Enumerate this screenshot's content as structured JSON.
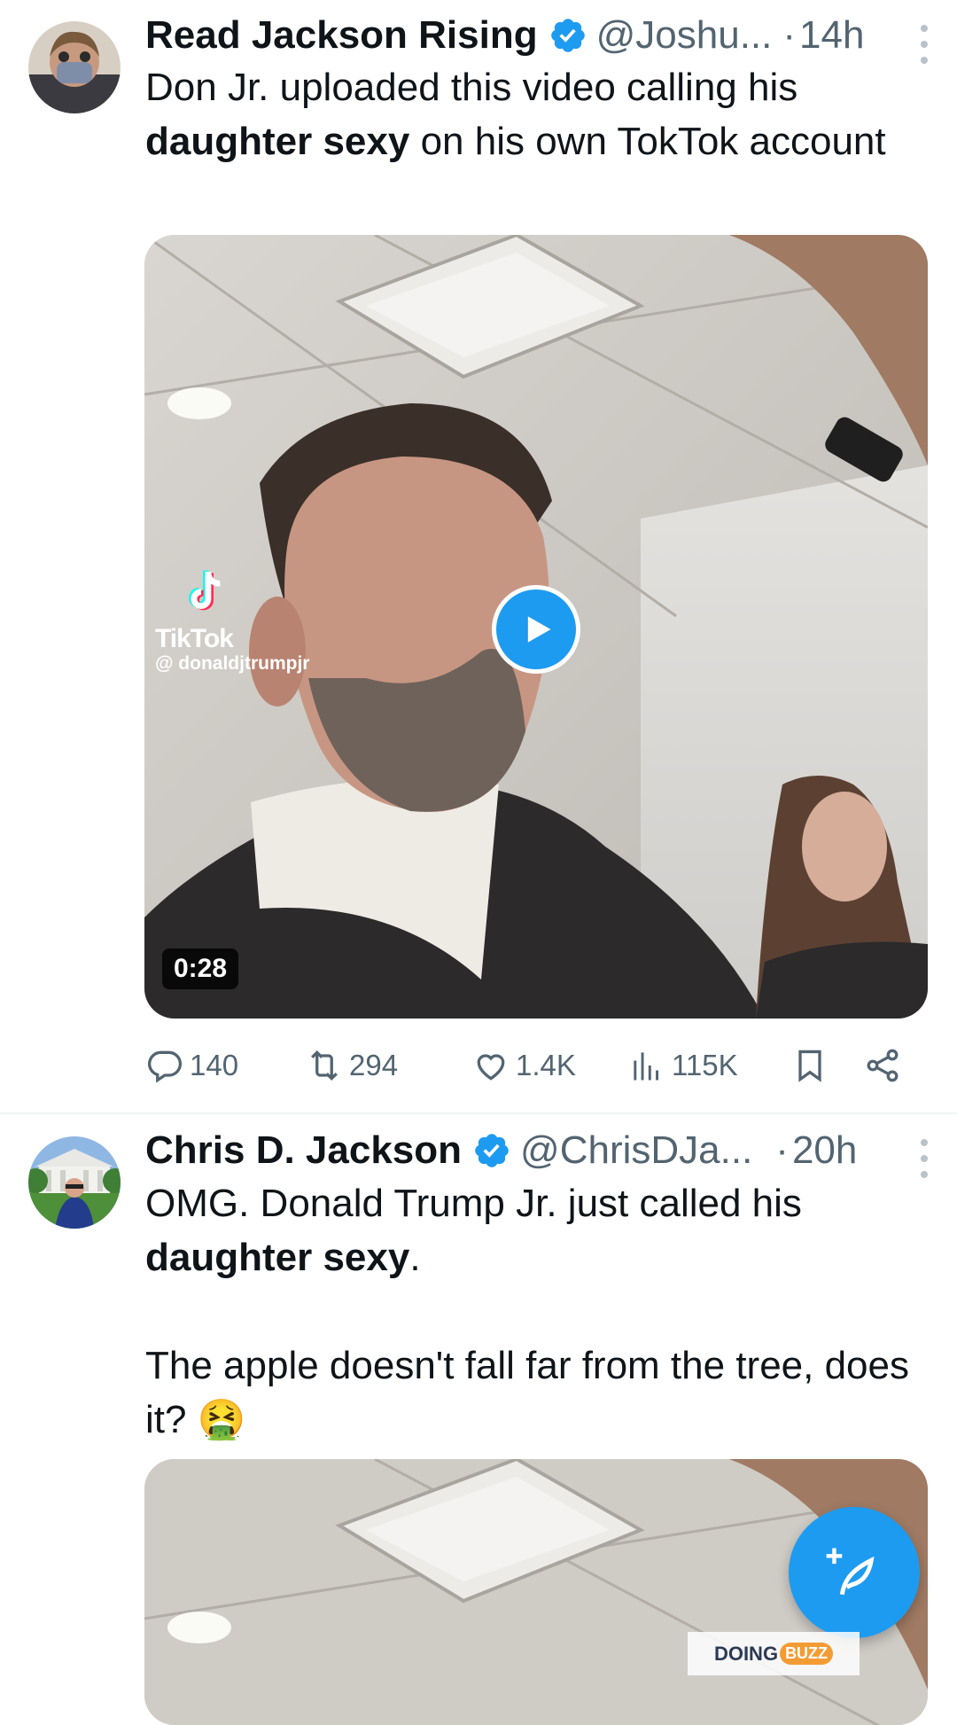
{
  "tweets": [
    {
      "name": "Read Jackson Rising",
      "handle": "@Joshu...",
      "dot": "·",
      "time": "14h",
      "text_parts": [
        "Don Jr. uploaded this video calling his ",
        "daughter sexy",
        " on his own TokTok account"
      ],
      "media": {
        "tiktok_brand": "TikTok",
        "tiktok_user": "@ donaldjtrumpjr",
        "duration": "0:28"
      },
      "actions": {
        "replies": "140",
        "reposts": "294",
        "likes": "1.4K",
        "views": "115K"
      }
    },
    {
      "name": "Chris D. Jackson",
      "handle": "@ChrisDJa...",
      "dot": "·",
      "time": "20h",
      "text_parts": [
        "OMG. Donald Trump Jr. just called his ",
        "daughter sexy",
        ".",
        "The apple doesn't fall far from the tree, does it? ",
        "🤮"
      ]
    }
  ],
  "watermark": {
    "left": "DOING",
    "right": "BUZZ"
  },
  "icons": {
    "verified": "verified-badge-icon",
    "reply": "reply-icon",
    "repost": "repost-icon",
    "like": "like-icon",
    "views": "views-icon",
    "bookmark": "bookmark-icon",
    "share": "share-icon",
    "compose": "compose-tweet-icon"
  },
  "colors": {
    "accent": "#1d9bf0",
    "muted": "#536471",
    "text": "#0f1419"
  }
}
